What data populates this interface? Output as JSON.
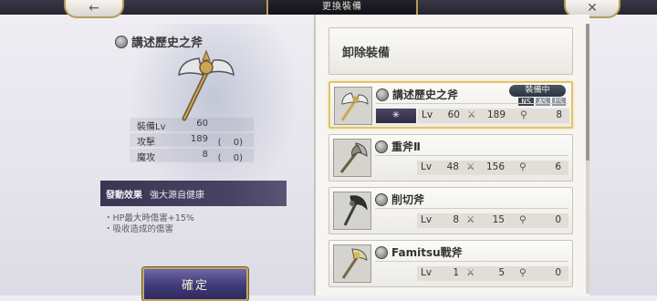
{
  "header": {
    "title": "更換裝備",
    "back_icon": "arrow-left-icon",
    "close_icon": "close-icon"
  },
  "left": {
    "item_name": "講述歷史之斧",
    "stats": [
      {
        "label": "裝備Lv",
        "value": "60",
        "bonus": ""
      },
      {
        "label": "攻擊",
        "value": "189",
        "bonus": "(　 0)"
      },
      {
        "label": "魔攻",
        "value": "8",
        "bonus": "(　 0)"
      }
    ],
    "effect_label": "發動效果",
    "effect_name": "強大源自健康",
    "effect_lines": [
      "・HP最大時傷害+15%",
      "・吸收造成的傷害"
    ],
    "confirm_label": "確定"
  },
  "right": {
    "unequip_label": "卸除裝備",
    "items": [
      {
        "name": "講述歷史之斧",
        "lv_label": "Lv",
        "lv": "60",
        "atk": "189",
        "matk": "8",
        "equipped": true,
        "badge": "裝備中",
        "tags": [
          "NS",
          "AS",
          "ES"
        ]
      },
      {
        "name": "重斧Ⅱ",
        "lv_label": "Lv",
        "lv": "48",
        "atk": "156",
        "matk": "6",
        "equipped": false
      },
      {
        "name": "削切斧",
        "lv_label": "Lv",
        "lv": "8",
        "atk": "15",
        "matk": "0",
        "equipped": false
      },
      {
        "name": "Famitsu戰斧",
        "lv_label": "Lv",
        "lv": "1",
        "atk": "5",
        "matk": "0",
        "equipped": false
      }
    ]
  }
}
